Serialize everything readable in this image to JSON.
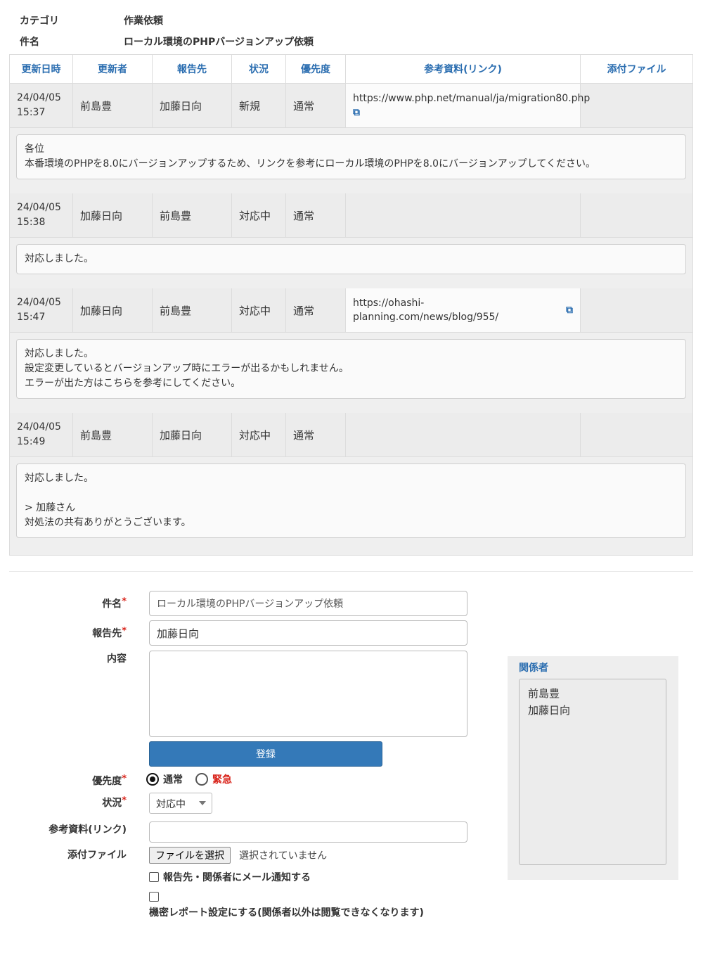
{
  "meta": {
    "category_label": "カテゴリ",
    "category_value": "作業依頼",
    "subject_label": "件名",
    "subject_value": "ローカル環境のPHPバージョンアップ依頼"
  },
  "table": {
    "headers": [
      "更新日時",
      "更新者",
      "報告先",
      "状況",
      "優先度",
      "参考資料(リンク)",
      "添付ファイル"
    ],
    "entries": [
      {
        "date": "24/04/05",
        "time": "15:37",
        "updater": "前島豊",
        "report_to": "加藤日向",
        "status": "新規",
        "priority": "通常",
        "link": "https://www.php.net/manual/ja/migration80.php",
        "attachment": "",
        "comment": "各位\n本番環境のPHPを8.0にバージョンアップするため、リンクを参考にローカル環境のPHPを8.0にバージョンアップしてください。"
      },
      {
        "date": "24/04/05",
        "time": "15:38",
        "updater": "加藤日向",
        "report_to": "前島豊",
        "status": "対応中",
        "priority": "通常",
        "link": "",
        "attachment": "",
        "comment": "対応しました。"
      },
      {
        "date": "24/04/05",
        "time": "15:47",
        "updater": "加藤日向",
        "report_to": "前島豊",
        "status": "対応中",
        "priority": "通常",
        "link": "https://ohashi-planning.com/news/blog/955/",
        "attachment": "",
        "comment": "対応しました。\n設定変更しているとバージョンアップ時にエラーが出るかもしれません。\nエラーが出た方はこちらを参考にしてください。"
      },
      {
        "date": "24/04/05",
        "time": "15:49",
        "updater": "前島豊",
        "report_to": "加藤日向",
        "status": "対応中",
        "priority": "通常",
        "link": "",
        "attachment": "",
        "comment": "対応しました。\n\n> 加藤さん\n対処法の共有ありがとうございます。"
      }
    ]
  },
  "form": {
    "subject_label": "件名",
    "subject_value": "ローカル環境のPHPバージョンアップ依頼",
    "report_to_label": "報告先",
    "report_to_value": "加藤日向",
    "content_label": "内容",
    "content_value": "",
    "register_button": "登録",
    "priority_label": "優先度",
    "priority_options": [
      "通常",
      "緊急"
    ],
    "priority_selected": "通常",
    "status_label": "状況",
    "status_selected": "対応中",
    "link_label": "参考資料(リンク)",
    "link_value": "",
    "attachment_label": "添付ファイル",
    "file_button": "ファイルを選択",
    "file_status": "選択されていません",
    "notify_label": "報告先・関係者にメール通知する",
    "secret_label": "機密レポート設定にする(関係者以外は閲覧できなくなります)",
    "required_mark": "*"
  },
  "related": {
    "title": "関係者",
    "members": [
      "前島豊",
      "加藤日向"
    ]
  },
  "colors": {
    "accent": "#2a6db0",
    "button": "#3479b8",
    "required": "#d9241b"
  }
}
